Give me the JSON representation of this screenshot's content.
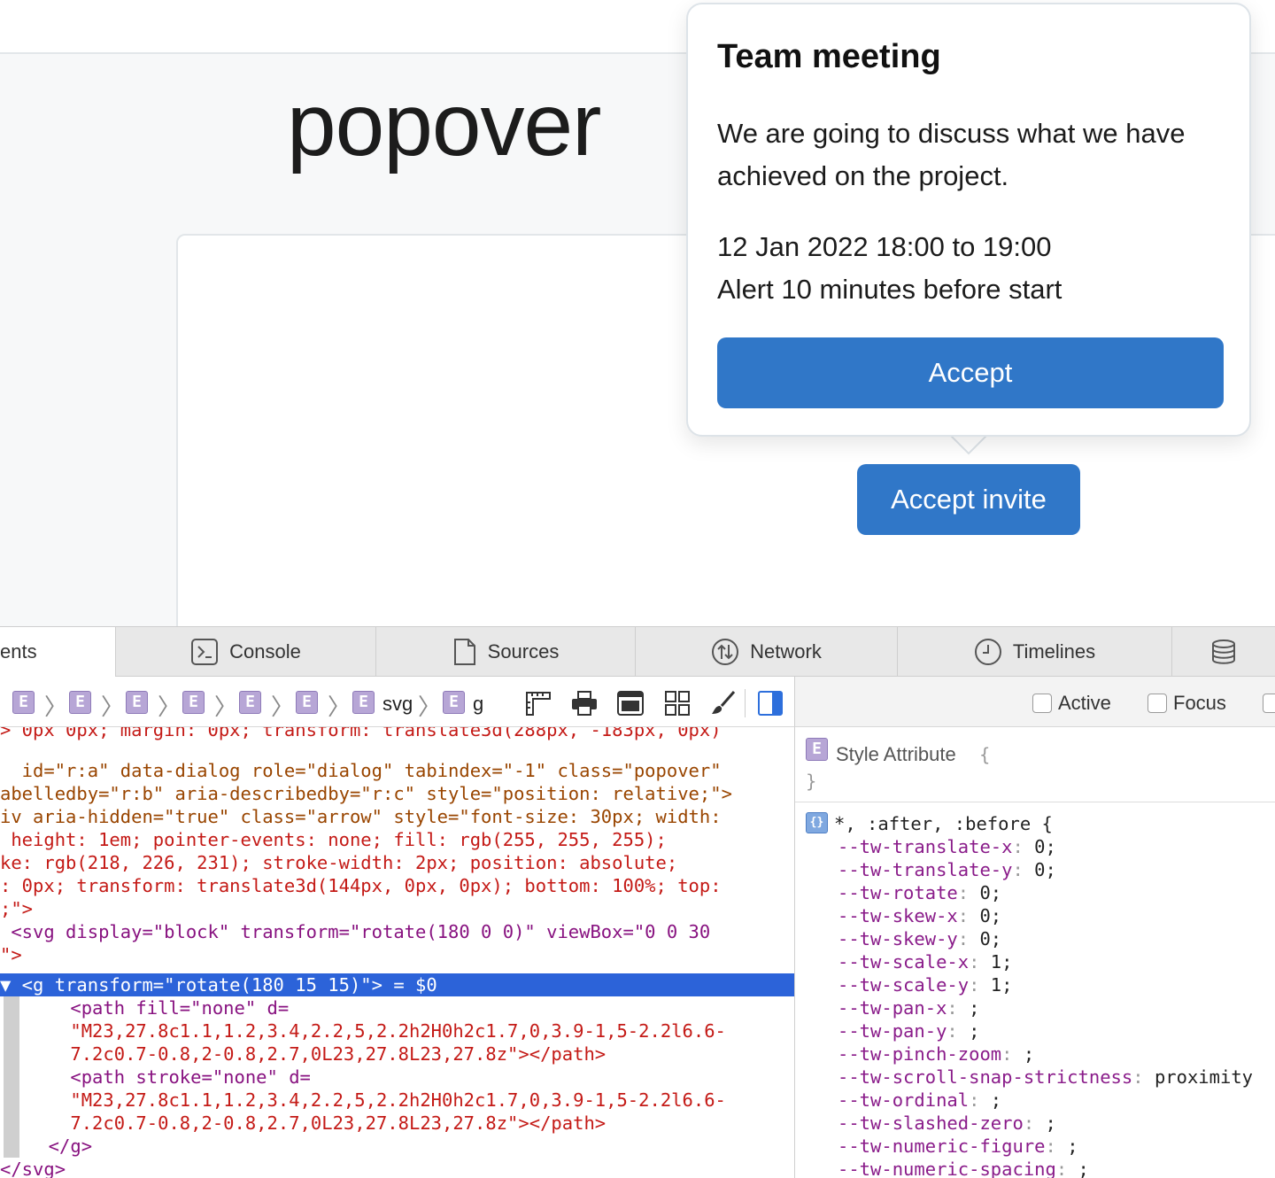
{
  "page": {
    "title": "popover",
    "trigger_button": "Accept invite"
  },
  "popover": {
    "title": "Team meeting",
    "description": "We are going to discuss what we have achieved on the project.",
    "time": "12 Jan 2022 18:00 to 19:00",
    "alert": "Alert 10 minutes before start",
    "accept_button": "Accept"
  },
  "devtools": {
    "tabs": [
      {
        "label": "ents",
        "icon": "elements-icon"
      },
      {
        "label": "Console",
        "icon": "console-icon"
      },
      {
        "label": "Sources",
        "icon": "document-icon"
      },
      {
        "label": "Network",
        "icon": "network-icon"
      },
      {
        "label": "Timelines",
        "icon": "clock-icon"
      },
      {
        "label": "",
        "icon": "storage-icon"
      }
    ],
    "breadcrumb": {
      "element_badge": "E",
      "separator": "〉",
      "svg_label": "svg",
      "g_label": "g"
    },
    "pseudo_classes": [
      "Active",
      "Focus"
    ],
    "dom_lines": [
      "> 0px 0px; margin: 0px; transform: translate3d(288px, -183px, 0px)",
      "  id=\"r:a\" data-dialog role=\"dialog\" tabindex=\"-1\" class=\"popover\"",
      "abelledby=\"r:b\" aria-describedby=\"r:c\" style=\"position: relative;\">",
      "iv aria-hidden=\"true\" class=\"arrow\" style=\"font-size: 30px; width:",
      " height: 1em; pointer-events: none; fill: rgb(255, 255, 255);",
      "ke: rgb(218, 226, 231); stroke-width: 2px; position: absolute;",
      ": 0px; transform: translate3d(144px, 0px, 0px); bottom: 100%; top:",
      ";\">",
      " <svg display=\"block\" transform=\"rotate(180 0 0)\" viewBox=\"0 0 30",
      "\">",
      "▼ <g transform=\"rotate(180 15 15)\"> = $0",
      "    <path fill=\"none\" d=",
      "    \"M23,27.8c1.1,1.2,3.4,2.2,5,2.2h2H0h2c1.7,0,3.9-1,5-2.2l6.6-",
      "    7.2c0.7-0.8,2-0.8,2.7,0L23,27.8L23,27.8z\"></path>",
      "    <path stroke=\"none\" d=",
      "    \"M23,27.8c1.1,1.2,3.4,2.2,5,2.2h2H0h2c1.7,0,3.9-1,5-2.2l6.6-",
      "    7.2c0.7-0.8,2-0.8,2.7,0L23,27.8L23,27.8z\"></path>",
      "  </g>",
      "</svg>"
    ],
    "styles": {
      "style_attribute_label": "Style Attribute",
      "open_brace": "{",
      "close_brace": "}",
      "rule_badge": "{}",
      "rule_selector": "*, :after, :before {",
      "declarations": [
        {
          "prop": "--tw-translate-x",
          "value": "0;"
        },
        {
          "prop": "--tw-translate-y",
          "value": "0;"
        },
        {
          "prop": "--tw-rotate",
          "value": "0;"
        },
        {
          "prop": "--tw-skew-x",
          "value": "0;"
        },
        {
          "prop": "--tw-skew-y",
          "value": "0;"
        },
        {
          "prop": "--tw-scale-x",
          "value": "1;"
        },
        {
          "prop": "--tw-scale-y",
          "value": "1;"
        },
        {
          "prop": "--tw-pan-x",
          "value": ";"
        },
        {
          "prop": "--tw-pan-y",
          "value": ";"
        },
        {
          "prop": "--tw-pinch-zoom",
          "value": ";"
        },
        {
          "prop": "--tw-scroll-snap-strictness",
          "value": "proximity"
        },
        {
          "prop": "--tw-ordinal",
          "value": ";"
        },
        {
          "prop": "--tw-slashed-zero",
          "value": ";"
        },
        {
          "prop": "--tw-numeric-figure",
          "value": ";"
        },
        {
          "prop": "--tw-numeric-spacing",
          "value": ";"
        }
      ]
    }
  },
  "colors": {
    "accent": "#3077c8",
    "selection": "#2c63d9",
    "element_badge": "#b7a6d6"
  }
}
